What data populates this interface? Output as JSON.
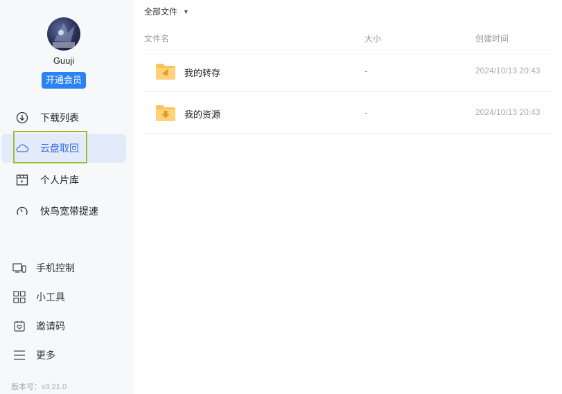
{
  "user": {
    "name": "Guuji",
    "vip_button": "开通会员"
  },
  "nav": [
    {
      "label": "下载列表",
      "icon": "download-icon",
      "active": false
    },
    {
      "label": "云盘取回",
      "icon": "cloud-icon",
      "active": true
    },
    {
      "label": "个人片库",
      "icon": "video-library-icon",
      "active": false
    },
    {
      "label": "快鸟宽带提速",
      "icon": "speedometer-icon",
      "active": false
    }
  ],
  "tools": [
    {
      "label": "手机控制",
      "icon": "devices-icon"
    },
    {
      "label": "小工具",
      "icon": "grid-icon"
    },
    {
      "label": "邀请码",
      "icon": "invite-icon"
    },
    {
      "label": "更多",
      "icon": "menu-icon"
    }
  ],
  "version": "版本号：v3.21.0",
  "filter": {
    "label": "全部文件"
  },
  "columns": {
    "name": "文件名",
    "size": "大小",
    "date": "创建时间"
  },
  "files": [
    {
      "name": "我的转存",
      "size": "-",
      "date": "2024/10/13 20:43",
      "icon": "folder-transfer-icon"
    },
    {
      "name": "我的资源",
      "size": "-",
      "date": "2024/10/13 20:43",
      "icon": "folder-download-icon"
    }
  ],
  "colors": {
    "accent": "#2a82f4",
    "active_bg": "#e3ebfb",
    "active_text": "#3a6fd8",
    "folder": "#fbc35a",
    "highlight": "#9bbf2a"
  }
}
